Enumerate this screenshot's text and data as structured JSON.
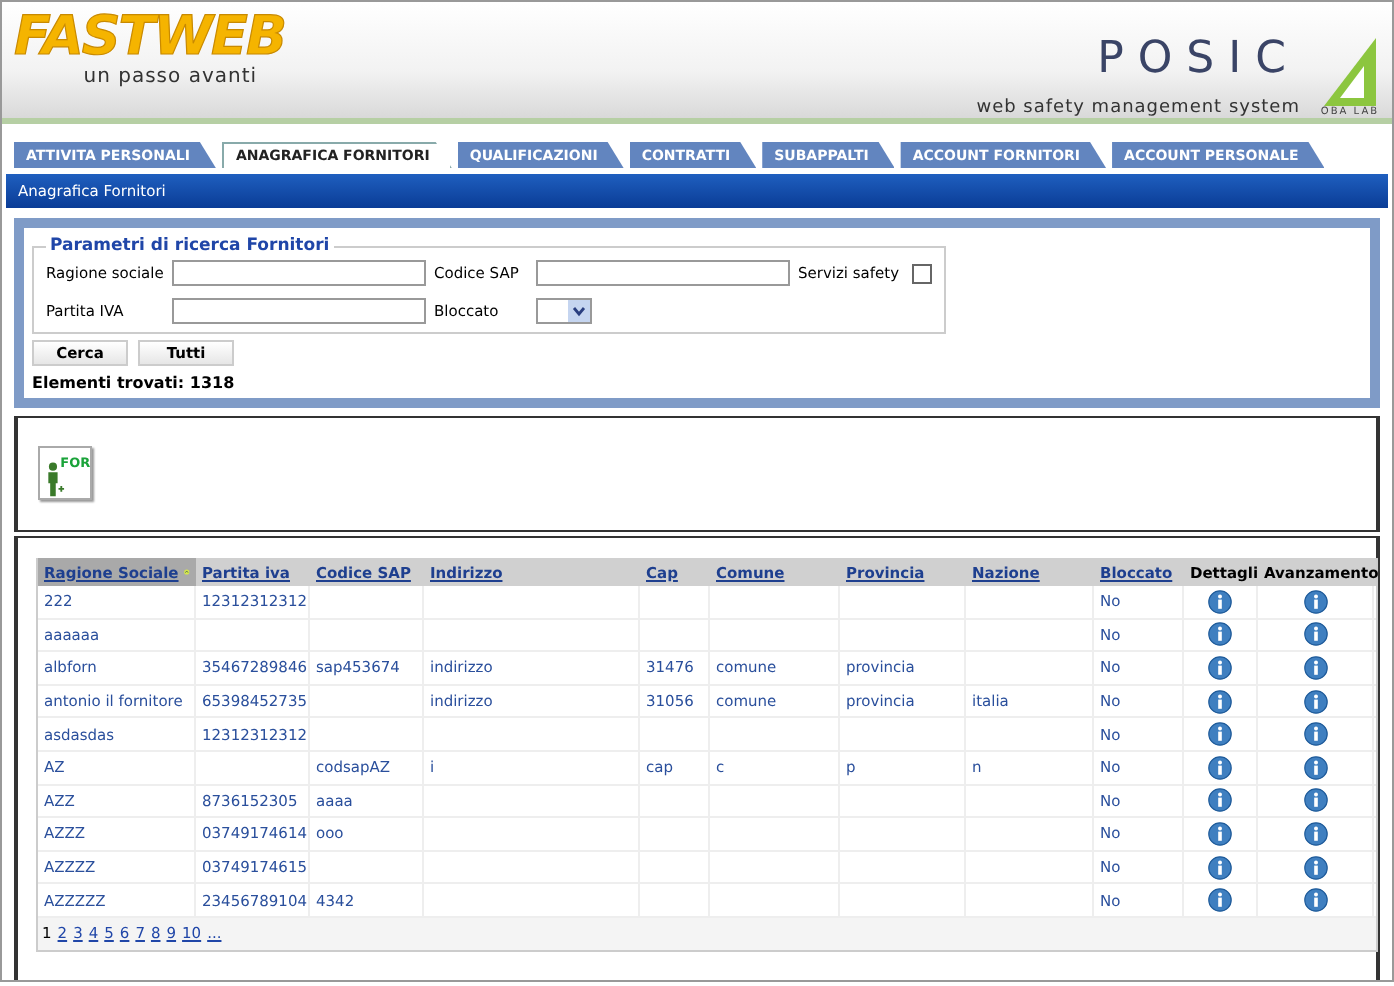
{
  "header": {
    "logo": "FASTWEB",
    "tagline": "un passo avanti",
    "app_name": "POSIC",
    "app_subtitle": "web safety management system",
    "vendor": "OBA LAB"
  },
  "tabs": [
    {
      "label": "ATTIVITA PERSONALI",
      "selected": false
    },
    {
      "label": "ANAGRAFICA FORNITORI",
      "selected": true
    },
    {
      "label": "QUALIFICAZIONI",
      "selected": false
    },
    {
      "label": "CONTRATTI",
      "selected": false
    },
    {
      "label": "SUBAPPALTI",
      "selected": false
    },
    {
      "label": "ACCOUNT FORNITORI",
      "selected": false
    },
    {
      "label": "ACCOUNT PERSONALE",
      "selected": false
    }
  ],
  "section_title": "Anagrafica Fornitori",
  "search": {
    "legend": "Parametri di ricerca Fornitori",
    "fields": [
      {
        "label": "Ragione sociale",
        "kind": "text"
      },
      {
        "label": "Codice SAP",
        "kind": "text"
      },
      {
        "label": "Servizi safety",
        "kind": "checkbox",
        "checked": false
      },
      {
        "label": "Partita IVA",
        "kind": "text"
      },
      {
        "label": "Bloccato",
        "kind": "select"
      }
    ],
    "buttons": [
      "Cerca",
      "Tutti"
    ],
    "result_label": "Elementi trovati:",
    "result_count": "1318"
  },
  "toolbar": {
    "add_button_label": "FOR"
  },
  "table": {
    "columns": [
      {
        "label": "Ragione Sociale",
        "kind": "link",
        "sorted": true
      },
      {
        "label": "Partita iva",
        "kind": "link",
        "sorted": false
      },
      {
        "label": "Codice SAP",
        "kind": "link",
        "sorted": false
      },
      {
        "label": "Indirizzo",
        "kind": "link",
        "sorted": false
      },
      {
        "label": "Cap",
        "kind": "link",
        "sorted": false
      },
      {
        "label": "Comune",
        "kind": "link",
        "sorted": false
      },
      {
        "label": "Provincia",
        "kind": "link",
        "sorted": false
      },
      {
        "label": "Nazione",
        "kind": "link",
        "sorted": false
      },
      {
        "label": "Bloccato",
        "kind": "link",
        "sorted": false
      },
      {
        "label": "Dettagli",
        "kind": "info",
        "sorted": false
      },
      {
        "label": "Avanzamento",
        "kind": "info",
        "sorted": false
      }
    ],
    "rows": [
      [
        "222",
        "12312312312",
        null,
        null,
        null,
        null,
        null,
        null,
        "No"
      ],
      [
        "aaaaaa",
        null,
        null,
        null,
        null,
        null,
        null,
        null,
        "No"
      ],
      [
        "albforn",
        "35467289846",
        "sap453674",
        "indirizzo",
        "31476",
        "comune",
        "provincia",
        null,
        "No"
      ],
      [
        "antonio il fornitore",
        "65398452735",
        null,
        "indirizzo",
        "31056",
        "comune",
        "provincia",
        "italia",
        "No"
      ],
      [
        "asdasdas",
        "12312312312",
        null,
        null,
        null,
        null,
        null,
        null,
        "No"
      ],
      [
        "AZ",
        null,
        "codsapAZ",
        "i",
        "cap",
        "c",
        "p",
        "n",
        "No"
      ],
      [
        "AZZ",
        "8736152305",
        "aaaa",
        null,
        null,
        null,
        null,
        null,
        "No"
      ],
      [
        "AZZZ",
        "03749174614",
        "ooo",
        null,
        null,
        null,
        null,
        null,
        "No"
      ],
      [
        "AZZZZ",
        "03749174615",
        null,
        null,
        null,
        null,
        null,
        null,
        "No"
      ],
      [
        "AZZZZZ",
        "23456789104",
        "4342",
        null,
        null,
        null,
        null,
        null,
        "No"
      ]
    ],
    "pages": [
      {
        "label": "1",
        "selected": true
      },
      {
        "label": "2",
        "selected": false
      },
      {
        "label": "3",
        "selected": false
      },
      {
        "label": "4",
        "selected": false
      },
      {
        "label": "5",
        "selected": false
      },
      {
        "label": "6",
        "selected": false
      },
      {
        "label": "7",
        "selected": false
      },
      {
        "label": "8",
        "selected": false
      },
      {
        "label": "9",
        "selected": false
      },
      {
        "label": "10",
        "selected": false
      },
      {
        "label": "...",
        "selected": false
      }
    ]
  }
}
